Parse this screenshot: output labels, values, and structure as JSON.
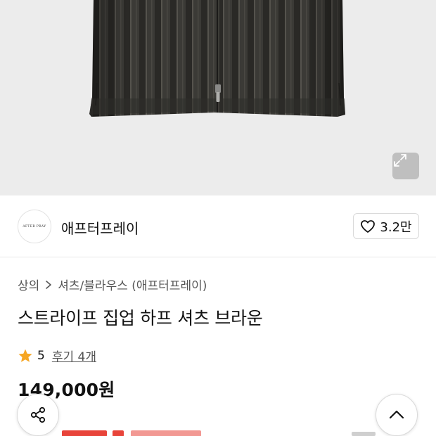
{
  "product_image": {
    "alt_icon": "striped-zip-shirt-image"
  },
  "expand_icon": "expand-icon",
  "brand": {
    "logo_text": "AFTER PRAY",
    "name": "애프터프레이",
    "likes": "3.2만"
  },
  "breadcrumb": {
    "items": [
      "상의",
      "셔츠/블라우스 (애프터프레이)"
    ],
    "separator_icon": "chevron-right-icon"
  },
  "product": {
    "title": "스트라이프 집업 하프 셔츠 브라운",
    "rating": "5",
    "review_link": "후기 4개",
    "price": "149,000원"
  },
  "fab": {
    "share_icon": "share-icon",
    "top_icon": "chevron-up-icon"
  },
  "colors": {
    "accent_red": "#e8443a",
    "star": "#f6a623",
    "hero_bg": "#ececec"
  }
}
